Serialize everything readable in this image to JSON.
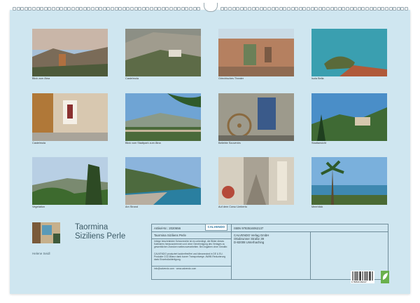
{
  "captions": [
    "Blick zum Ätna",
    "Castelmola",
    "Griechisches Theater",
    "Isola Bella",
    "Castelmola",
    "Blick vom Stadtpark zum Ätna",
    "Beliebte Souvenirs",
    "Stadtansicht",
    "Vegetation",
    "Am Strand",
    "Auf dem Corso Umberto",
    "Meerblick"
  ],
  "title_line1": "Taormina",
  "title_line2": "Siziliens Perle",
  "author": "Helene Seidl",
  "article_label": "Artikel-Nr.: 2020656",
  "logo": "CALVENDO",
  "calendar_name": "Taormina Siziliens Perle",
  "isbn": "ISBN 9783516062137",
  "publisher": [
    "CALVENDO Verlag GmbH",
    "Ottobrunner Straße 39",
    "D-82008 Unterhaching"
  ],
  "legal_text": "Infolge beschränkter Schutzrechte ist es unbedingt, die Bilder dieses Kalenders herauszutrennen und ohne Genehmigung des Verlages zu gewerblichen Zwecken weiterzuverarbeiten. Bei Angaben ohne Gewähr.",
  "eco_text": "CALVENDO produziert lackiertfrei/frei und klimaneutral in DE & EU. Produkte CO2-Bilanz dank kurzer Transportwege. AWMI-Reduzierung dank Einzelstückfertigung.",
  "contact": "info@calvendo.com · www.calvendo.com",
  "barcode_number": "9 783516 062137"
}
